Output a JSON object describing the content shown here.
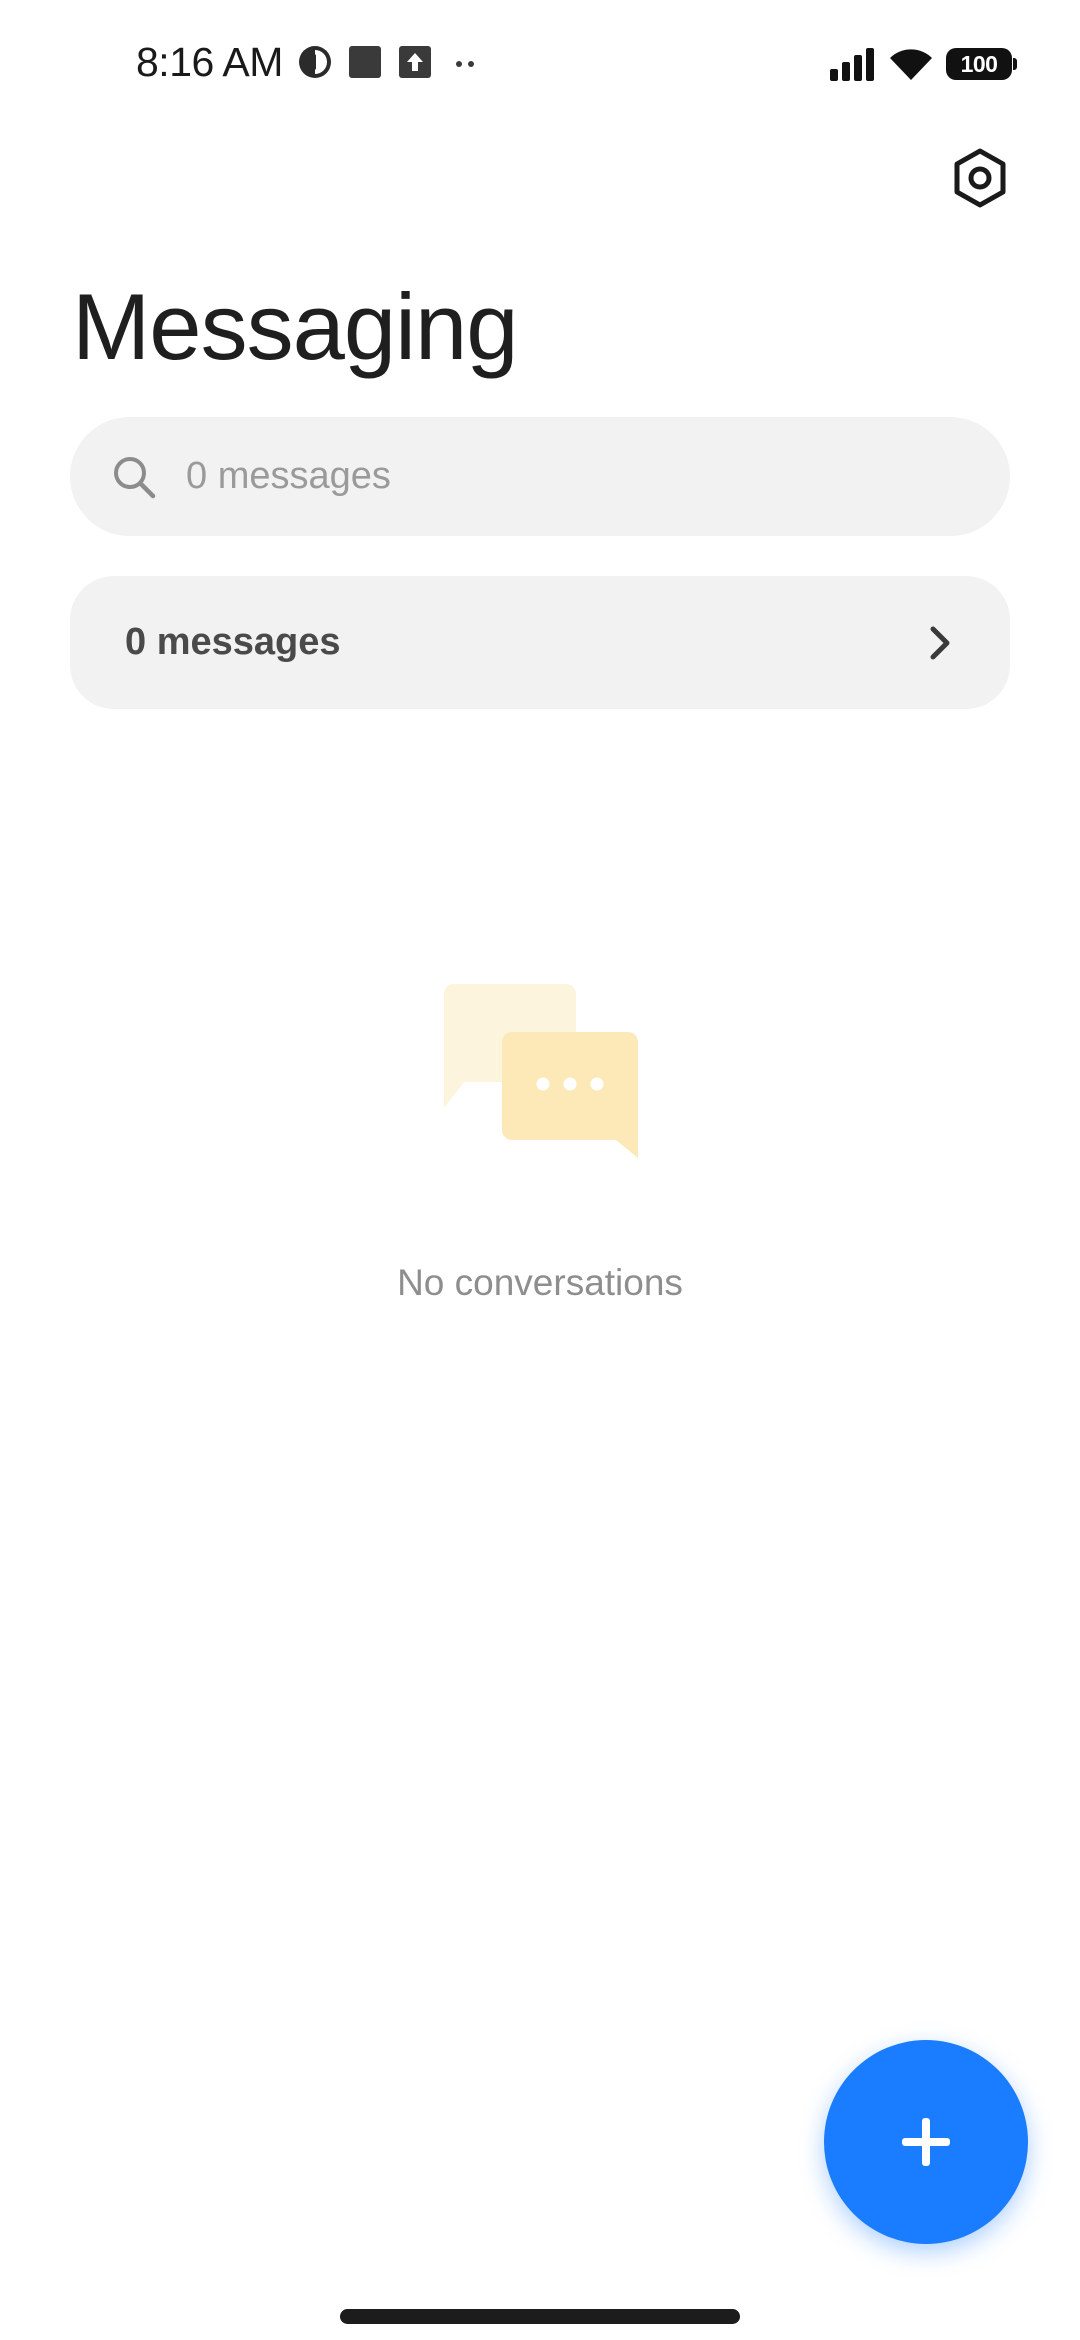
{
  "status_bar": {
    "time": "8:16 AM",
    "notification_icons": [
      "data-usage-icon",
      "square-notification-icon",
      "upload-icon",
      "more-dots-icon"
    ],
    "signal_icon": "cellular-signal-icon",
    "wifi_icon": "wifi-icon",
    "battery_level": "100"
  },
  "header": {
    "title": "Messaging",
    "settings_icon": "settings-icon"
  },
  "search": {
    "placeholder": "0 messages",
    "value": ""
  },
  "messages_row": {
    "label": "0 messages"
  },
  "empty_state": {
    "illustration_icon": "chat-bubbles-icon",
    "text": "No conversations"
  },
  "fab": {
    "icon": "plus-icon"
  },
  "colors": {
    "accent": "#1a7cff",
    "illustration": "#fde9b8",
    "surface": "#f2f2f2",
    "background": "#ffffff"
  }
}
